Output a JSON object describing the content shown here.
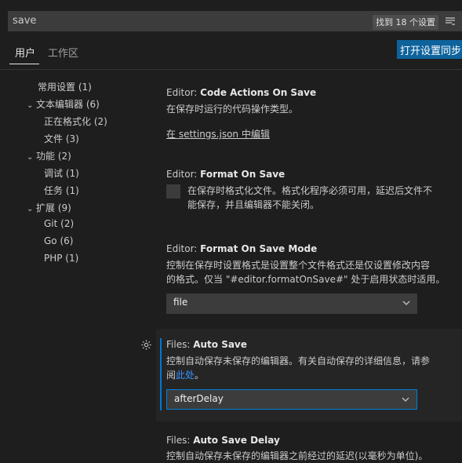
{
  "search": {
    "value": "save",
    "result_count": "找到 18 个设置"
  },
  "tabs": {
    "user": "用户",
    "workspace": "工作区",
    "sync_button": "打开设置同步"
  },
  "tree": {
    "common": "常用设置 (1)",
    "text_editor": "文本编辑器 (6)",
    "formatting": "正在格式化 (2)",
    "files": "文件 (3)",
    "features": "功能 (2)",
    "debug": "调试 (1)",
    "tasks": "任务 (1)",
    "extensions": "扩展 (9)",
    "git": "Git (2)",
    "go": "Go (6)",
    "php": "PHP (1)"
  },
  "settings": {
    "code_actions": {
      "category": "Editor: ",
      "name": "Code Actions On Save",
      "desc": "在保存时运行的代码操作类型。",
      "edit_link": "在 settings.json 中编辑"
    },
    "format_on_save": {
      "category": "Editor: ",
      "name": "Format On Save",
      "desc_line1": "在保存时格式化文件。格式化程序必须可用，延迟后文件不",
      "desc_line2": "能保存，并且编辑器不能关闭。",
      "checked": false
    },
    "format_on_save_mode": {
      "category": "Editor: ",
      "name": "Format On Save Mode",
      "desc_line1": "控制在保存时设置格式是设置整个文件格式还是仅设置修改内容",
      "desc_line2": "的格式。仅当 \"#editor.formatOnSave#\" 处于启用状态时适用。",
      "value": "file"
    },
    "auto_save": {
      "category": "Files: ",
      "name": "Auto Save",
      "desc_line1": "控制自动保存未保存的编辑器。有关自动保存的详细信息，请参",
      "desc_line2_prefix": "阅",
      "desc_link": "此处",
      "desc_line2_suffix": "。",
      "value": "afterDelay"
    },
    "auto_save_delay": {
      "category": "Files: ",
      "name": "Auto Save Delay",
      "desc_line1": "控制自动保存未保存的编辑器之前经过的延迟(以毫秒为单位)。"
    }
  },
  "colors": {
    "accent": "#0e639c",
    "focus": "#007fd4",
    "link": "#3794ff"
  }
}
